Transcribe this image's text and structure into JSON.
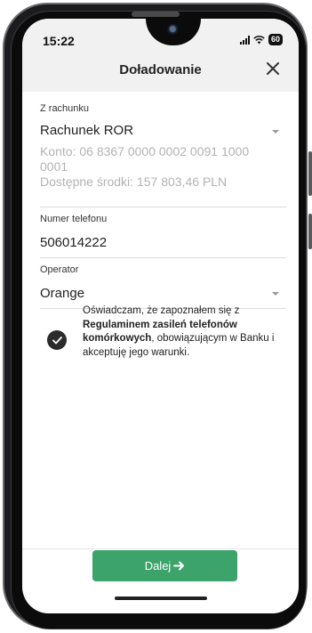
{
  "status": {
    "time": "15:22",
    "battery": "60"
  },
  "header": {
    "title": "Doładowanie"
  },
  "account": {
    "label": "Z rachunku",
    "value": "Rachunek ROR",
    "number_line1": "Konto: 06 8367 0000 0002 0091 1000",
    "number_line2": "0001",
    "funds": "Dostępne środki: 157 803,46 PLN"
  },
  "phone": {
    "label": "Numer telefonu",
    "value": "506014222"
  },
  "operator": {
    "label": "Operator",
    "value": "Orange"
  },
  "consent": {
    "intro": "Oświadczam, że zapoznałem się z",
    "bold": "Regulaminem zasileń telefonów komórkowych",
    "rest": ", obowiązującym w Banku i akceptuję jego warunki.",
    "checked": true
  },
  "footer": {
    "next_label": "Dalej"
  },
  "colors": {
    "accent": "#3ca36a",
    "header_bg": "#f1f1f1",
    "muted_text": "#b3b3b3"
  }
}
